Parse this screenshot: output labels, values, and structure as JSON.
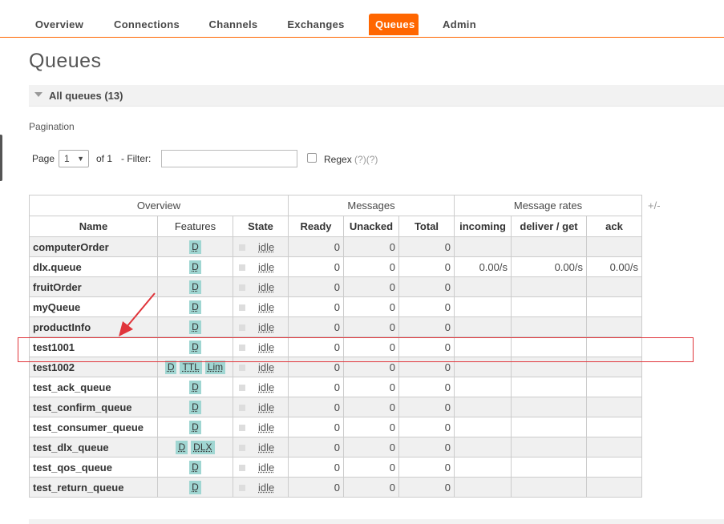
{
  "nav": {
    "items": [
      {
        "label": "Overview"
      },
      {
        "label": "Connections"
      },
      {
        "label": "Channels"
      },
      {
        "label": "Exchanges"
      },
      {
        "label": "Queues",
        "active": true
      },
      {
        "label": "Admin"
      }
    ]
  },
  "page_title": "Queues",
  "section": {
    "title": "All queues (13)"
  },
  "pagination": {
    "label": "Pagination",
    "page_label": "Page",
    "page_value": "1",
    "of_label": "of 1",
    "filter_label": "- Filter:",
    "filter_value": "",
    "regex_label": "Regex",
    "regex_help": "(?)(?)"
  },
  "table": {
    "group_headers": [
      "Overview",
      "Messages",
      "Message rates"
    ],
    "columns": [
      "Name",
      "Features",
      "State",
      "Ready",
      "Unacked",
      "Total",
      "incoming",
      "deliver / get",
      "ack"
    ],
    "plus_minus": "+/-",
    "rows": [
      {
        "name": "computerOrder",
        "features": [
          "D"
        ],
        "state": "idle",
        "ready": "0",
        "unacked": "0",
        "total": "0",
        "incoming": "",
        "deliver": "",
        "ack": ""
      },
      {
        "name": "dlx.queue",
        "features": [
          "D"
        ],
        "state": "idle",
        "ready": "0",
        "unacked": "0",
        "total": "0",
        "incoming": "0.00/s",
        "deliver": "0.00/s",
        "ack": "0.00/s"
      },
      {
        "name": "fruitOrder",
        "features": [
          "D"
        ],
        "state": "idle",
        "ready": "0",
        "unacked": "0",
        "total": "0",
        "incoming": "",
        "deliver": "",
        "ack": ""
      },
      {
        "name": "myQueue",
        "features": [
          "D"
        ],
        "state": "idle",
        "ready": "0",
        "unacked": "0",
        "total": "0",
        "incoming": "",
        "deliver": "",
        "ack": ""
      },
      {
        "name": "productInfo",
        "features": [
          "D"
        ],
        "state": "idle",
        "ready": "0",
        "unacked": "0",
        "total": "0",
        "incoming": "",
        "deliver": "",
        "ack": ""
      },
      {
        "name": "test1001",
        "features": [
          "D"
        ],
        "state": "idle",
        "ready": "0",
        "unacked": "0",
        "total": "0",
        "incoming": "",
        "deliver": "",
        "ack": ""
      },
      {
        "name": "test1002",
        "features": [
          "D",
          "TTL",
          "Lim"
        ],
        "state": "idle",
        "ready": "0",
        "unacked": "0",
        "total": "0",
        "incoming": "",
        "deliver": "",
        "ack": ""
      },
      {
        "name": "test_ack_queue",
        "features": [
          "D"
        ],
        "state": "idle",
        "ready": "0",
        "unacked": "0",
        "total": "0",
        "incoming": "",
        "deliver": "",
        "ack": ""
      },
      {
        "name": "test_confirm_queue",
        "features": [
          "D"
        ],
        "state": "idle",
        "ready": "0",
        "unacked": "0",
        "total": "0",
        "incoming": "",
        "deliver": "",
        "ack": ""
      },
      {
        "name": "test_consumer_queue",
        "features": [
          "D"
        ],
        "state": "idle",
        "ready": "0",
        "unacked": "0",
        "total": "0",
        "incoming": "",
        "deliver": "",
        "ack": ""
      },
      {
        "name": "test_dlx_queue",
        "features": [
          "D",
          "DLX"
        ],
        "state": "idle",
        "ready": "0",
        "unacked": "0",
        "total": "0",
        "incoming": "",
        "deliver": "",
        "ack": ""
      },
      {
        "name": "test_qos_queue",
        "features": [
          "D"
        ],
        "state": "idle",
        "ready": "0",
        "unacked": "0",
        "total": "0",
        "incoming": "",
        "deliver": "",
        "ack": ""
      },
      {
        "name": "test_return_queue",
        "features": [
          "D"
        ],
        "state": "idle",
        "ready": "0",
        "unacked": "0",
        "total": "0",
        "incoming": "",
        "deliver": "",
        "ack": ""
      }
    ]
  },
  "colors": {
    "accent": "#ff6600",
    "feature_chip": "#a0d6d2",
    "annotation": "#e0353b"
  }
}
